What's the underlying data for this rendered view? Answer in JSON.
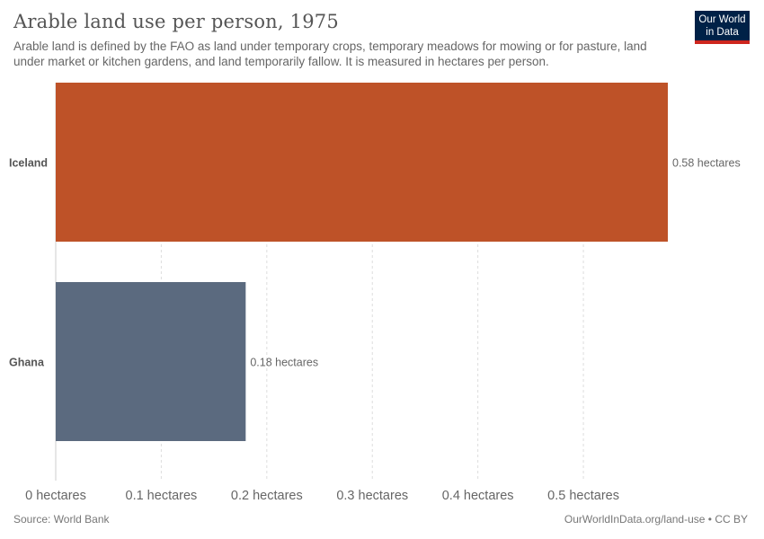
{
  "header": {
    "title": "Arable land use per person, 1975",
    "subtitle": "Arable land is defined by the FAO as land under temporary crops, temporary meadows for mowing or for pasture, land under market or kitchen gardens, and land temporarily fallow. It is measured in hectares per person."
  },
  "logo": {
    "line1": "Our World",
    "line2": "in Data"
  },
  "footer": {
    "source": "Source: World Bank",
    "license": "OurWorldInData.org/land-use • CC BY"
  },
  "chart_data": {
    "type": "bar",
    "orientation": "horizontal",
    "title": "Arable land use per person, 1975",
    "categories": [
      "Iceland",
      "Ghana"
    ],
    "values": [
      0.58,
      0.18
    ],
    "value_labels": [
      "0.58 hectares",
      "0.18 hectares"
    ],
    "colors": [
      "#be5228",
      "#5b6a7f"
    ],
    "xlim": [
      0,
      0.58
    ],
    "ticks": [
      0,
      0.1,
      0.2,
      0.3,
      0.4,
      0.5
    ],
    "tick_labels": [
      "0 hectares",
      "0.1 hectares",
      "0.2 hectares",
      "0.3 hectares",
      "0.4 hectares",
      "0.5 hectares"
    ],
    "grid": true
  }
}
